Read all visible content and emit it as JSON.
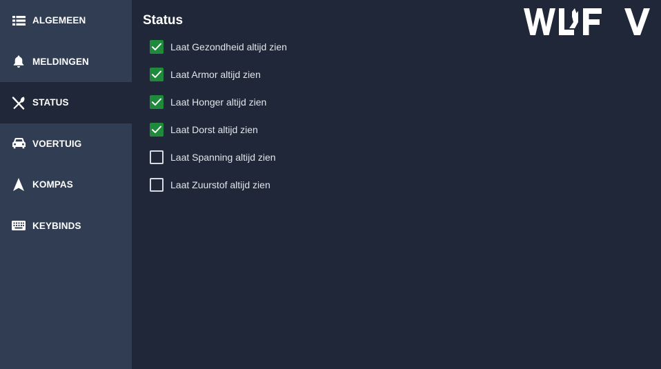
{
  "sidebar": {
    "items": [
      {
        "label": "ALGEMEEN",
        "icon": "list-icon",
        "active": false
      },
      {
        "label": "MELDINGEN",
        "icon": "bell-icon",
        "active": false
      },
      {
        "label": "STATUS",
        "icon": "utensils-icon",
        "active": true
      },
      {
        "label": "VOERTUIG",
        "icon": "car-icon",
        "active": false
      },
      {
        "label": "KOMPAS",
        "icon": "navigation-arrow-icon",
        "active": false
      },
      {
        "label": "KEYBINDS",
        "icon": "keyboard-icon",
        "active": false
      }
    ]
  },
  "main": {
    "title": "Status",
    "options": [
      {
        "label": "Laat Gezondheid altijd zien",
        "checked": true
      },
      {
        "label": "Laat Armor altijd zien",
        "checked": true
      },
      {
        "label": "Laat Honger altijd zien",
        "checked": true
      },
      {
        "label": "Laat Dorst altijd zien",
        "checked": true
      },
      {
        "label": "Laat Spanning altijd zien",
        "checked": false
      },
      {
        "label": "Laat Zuurstof altijd zien",
        "checked": false
      }
    ]
  },
  "logo": {
    "text": "WLFV"
  },
  "colors": {
    "sidebar_bg": "#303d52",
    "main_bg": "#1f2738",
    "checkbox_checked": "#1f8a3c",
    "text": "#ffffff"
  }
}
